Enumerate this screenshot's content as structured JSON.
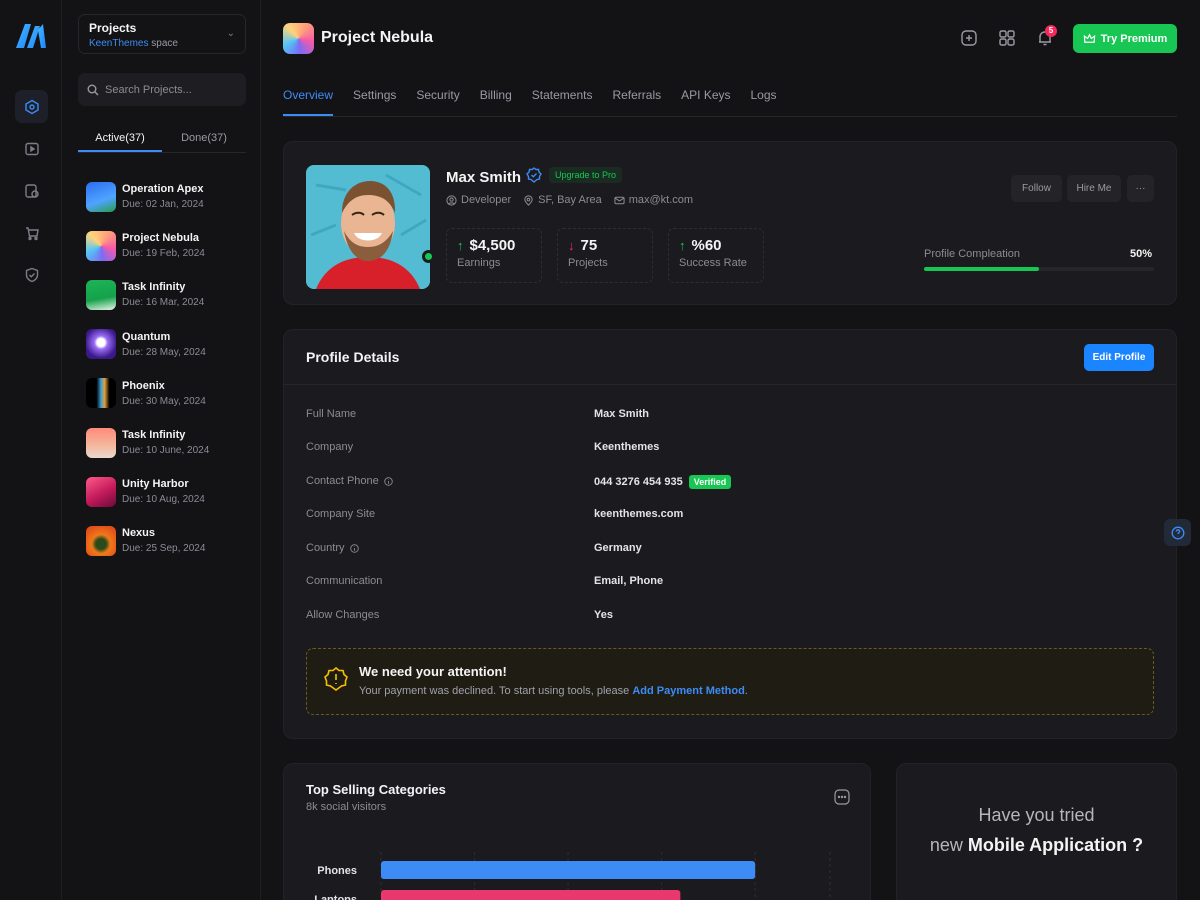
{
  "projects_panel": {
    "switch_title": "Projects",
    "switch_brand": "KeenThemes",
    "switch_suffix": "space",
    "search_placeholder": "Search Projects...",
    "tab_active": "Active(37)",
    "tab_done": "Done(37)",
    "items": [
      {
        "name": "Operation Apex",
        "due": "Due: 02 Jan, 2024"
      },
      {
        "name": "Project Nebula",
        "due": "Due: 19 Feb, 2024"
      },
      {
        "name": "Task Infinity",
        "due": "Due: 16 Mar, 2024"
      },
      {
        "name": "Quantum",
        "due": "Due: 28 May, 2024"
      },
      {
        "name": "Phoenix",
        "due": "Due: 30 May, 2024"
      },
      {
        "name": "Task Infinity",
        "due": "Due: 10 June, 2024"
      },
      {
        "name": "Unity Harbor",
        "due": "Due: 10 Aug, 2024"
      },
      {
        "name": "Nexus",
        "due": "Due: 25 Sep, 2024"
      }
    ]
  },
  "header": {
    "title": "Project Nebula",
    "notification_count": "5",
    "premium_label": "Try Premium"
  },
  "tabs": [
    "Overview",
    "Settings",
    "Security",
    "Billing",
    "Statements",
    "Referrals",
    "API Keys",
    "Logs"
  ],
  "profile": {
    "name": "Max Smith",
    "upgrade": "Upgrade to Pro",
    "role": "Developer",
    "location": "SF, Bay Area",
    "email": "max@kt.com",
    "stats": [
      {
        "value": "$4,500",
        "label": "Earnings",
        "trend": "up"
      },
      {
        "value": "75",
        "label": "Projects",
        "trend": "down"
      },
      {
        "value": "%60",
        "label": "Success Rate",
        "trend": "up"
      }
    ],
    "follow": "Follow",
    "hire": "Hire Me",
    "more": "···",
    "completion_label": "Profile Compleation",
    "completion_value": "50%",
    "completion_fraction": 0.5
  },
  "details": {
    "title": "Profile Details",
    "edit": "Edit Profile",
    "rows": [
      {
        "key": "Full Name",
        "value": "Max Smith"
      },
      {
        "key": "Company",
        "value": "Keenthemes"
      },
      {
        "key": "Contact Phone",
        "value": "044 3276 454 935",
        "badge": "Verified"
      },
      {
        "key": "Company Site",
        "value": "keenthemes.com"
      },
      {
        "key": "Country",
        "value": "Germany"
      },
      {
        "key": "Communication",
        "value": "Email, Phone"
      },
      {
        "key": "Allow Changes",
        "value": "Yes"
      }
    ],
    "alert_title": "We need your attention!",
    "alert_text": "Your payment was declined. To start using tools, please ",
    "alert_link": "Add Payment Method",
    "alert_end": "."
  },
  "top_selling": {
    "title": "Top Selling Categories",
    "subtitle": "8k social visitors"
  },
  "chart_data": {
    "type": "bar",
    "title": "Top Selling Categories",
    "orientation": "horizontal",
    "categories": [
      "Phones",
      "Laptops"
    ],
    "values": [
      100,
      80
    ],
    "colors": [
      "#3d8cf5",
      "#e8386d"
    ],
    "grid": true
  },
  "mobile": {
    "line1": "Have you tried",
    "line2_prefix": "new ",
    "line2_bold": "Mobile Application ?"
  },
  "colors": {
    "accent": "#3d8cf5",
    "success": "#17c653",
    "danger": "#f8285a",
    "warning": "#f6c000"
  }
}
